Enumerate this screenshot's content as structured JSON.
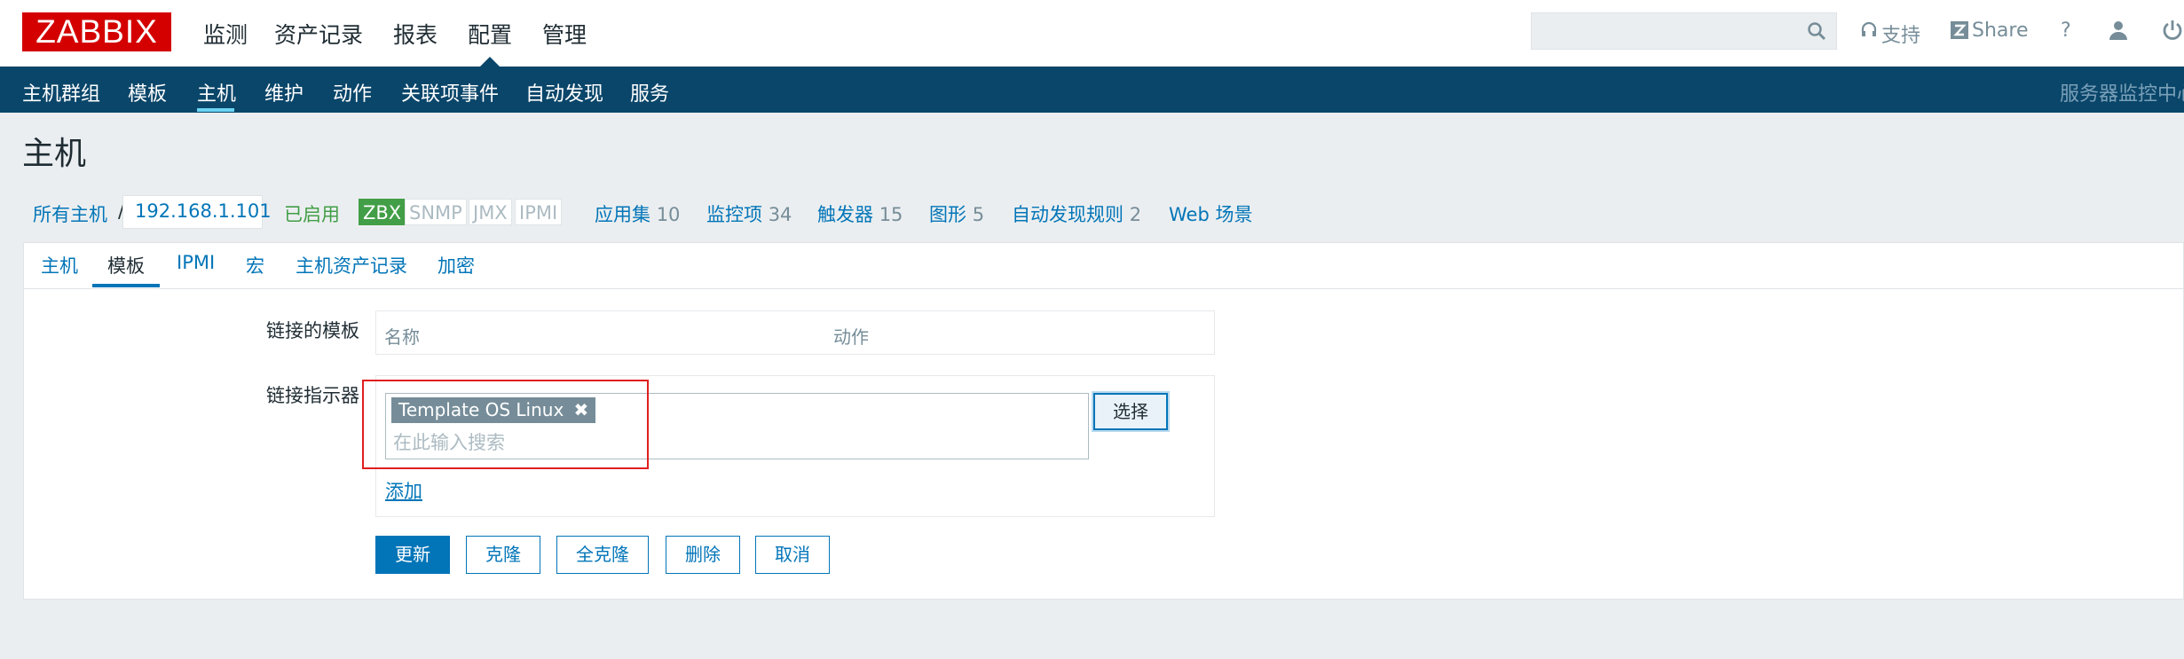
{
  "logo": "ZABBIX",
  "main_nav": [
    "监测",
    "资产记录",
    "报表",
    "配置",
    "管理"
  ],
  "active_main": "配置",
  "top_util": {
    "support": "支持",
    "share": "Share",
    "help": "?"
  },
  "sub_nav": [
    "主机群组",
    "模板",
    "主机",
    "维护",
    "动作",
    "关联项事件",
    "自动发现",
    "服务"
  ],
  "active_sub": "主机",
  "server_name": "服务器监控中心",
  "page_title": "主机",
  "breadcrumb": {
    "all_hosts": "所有主机",
    "separator": "/",
    "host": "192.168.1.101",
    "status": "已启用",
    "availability": [
      "ZBX",
      "SNMP",
      "JMX",
      "IPMI"
    ],
    "links": [
      {
        "label": "应用集",
        "count": "10"
      },
      {
        "label": "监控项",
        "count": "34"
      },
      {
        "label": "触发器",
        "count": "15"
      },
      {
        "label": "图形",
        "count": "5"
      },
      {
        "label": "自动发现规则",
        "count": "2"
      },
      {
        "label": "Web 场景",
        "count": ""
      }
    ]
  },
  "tabs": [
    "主机",
    "模板",
    "IPMI",
    "宏",
    "主机资产记录",
    "加密"
  ],
  "active_tab": "模板",
  "form": {
    "linked_templates_label": "链接的模板",
    "col_name": "名称",
    "col_action": "动作",
    "link_indicator_label": "链接指示器",
    "selected_template": "Template OS Linux",
    "remove_glyph": "✖",
    "search_placeholder": "在此输入搜索",
    "select_button": "选择",
    "add_link": "添加"
  },
  "buttons": [
    "更新",
    "克隆",
    "全克隆",
    "删除",
    "取消"
  ],
  "colors": {
    "brand": "#d40000",
    "nav": "#0a466a",
    "link": "#0275b8",
    "enabled": "#429e47",
    "highlight": "#e01e1e"
  }
}
